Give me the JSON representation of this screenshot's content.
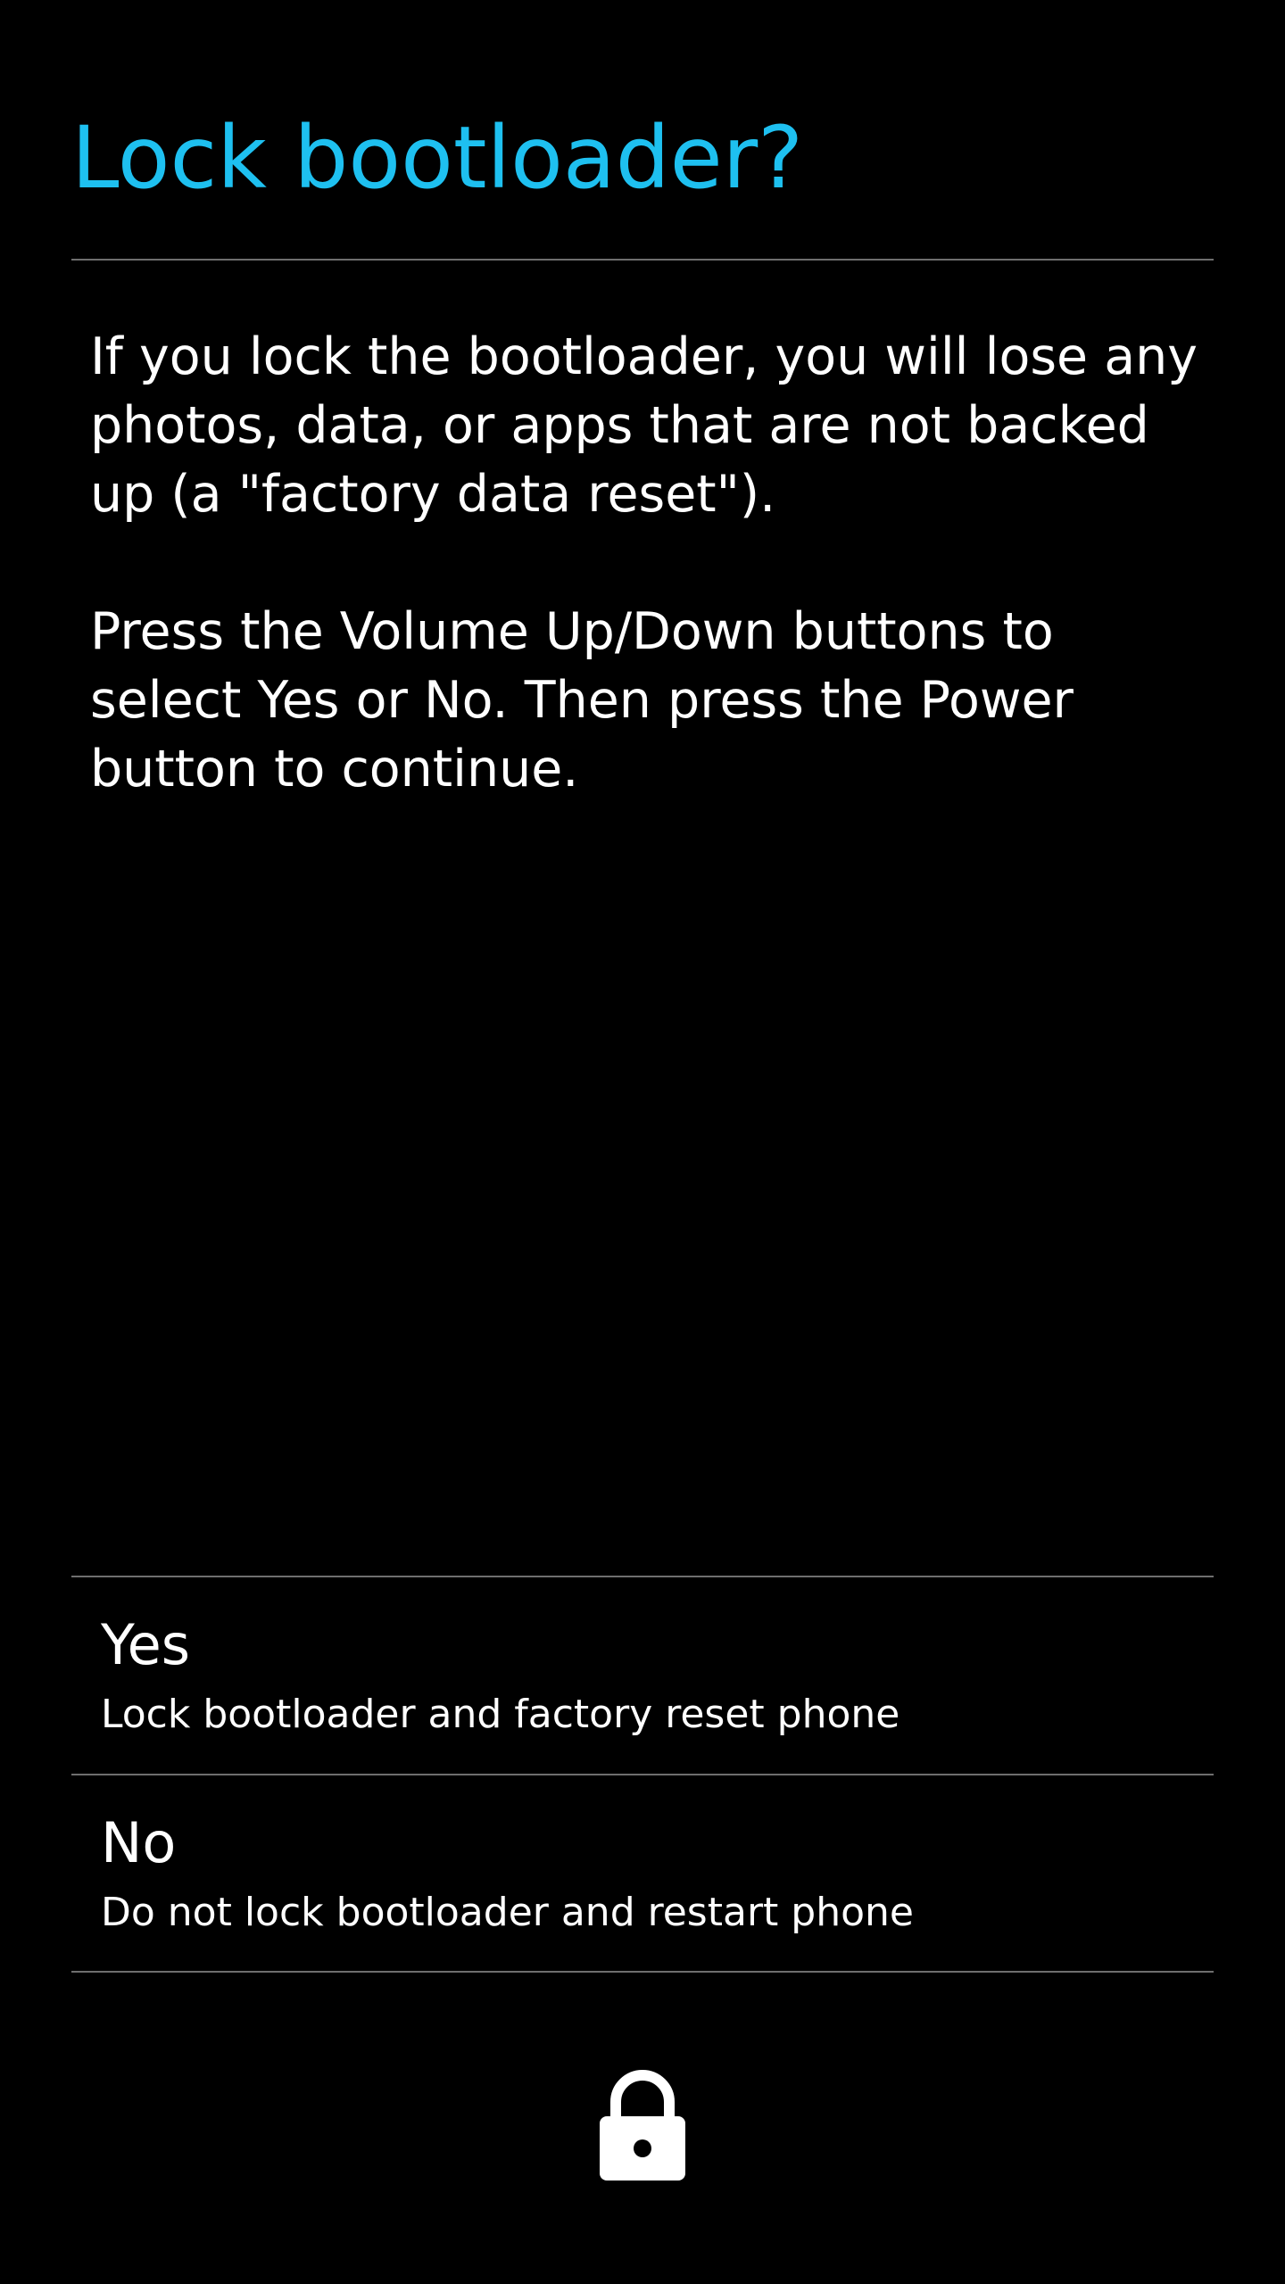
{
  "title": "Lock bootloader?",
  "message": {
    "paragraph_1": "If you lock the bootloader, you will lose any photos, data, or apps that are not backed up (a \"factory data reset\").",
    "paragraph_2": "Press the Volume Up/Down buttons to select Yes or No. Then press the Power button to continue."
  },
  "options": [
    {
      "label": "Yes",
      "description": "Lock bootloader and factory reset phone"
    },
    {
      "label": "No",
      "description": "Do not lock bootloader and restart phone"
    }
  ],
  "footer_icon": "lock-icon",
  "colors": {
    "accent": "#1ec0f0",
    "background": "#000000",
    "text": "#ffffff",
    "divider": "#6e6e6e"
  }
}
